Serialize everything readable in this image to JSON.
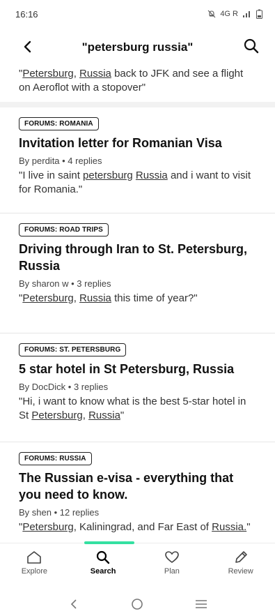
{
  "status": {
    "time": "16:16",
    "icons_text": "4G R"
  },
  "header": {
    "title": "\"petersburg russia\""
  },
  "results": [
    {
      "snippet_parts": [
        {
          "t": "\""
        },
        {
          "t": "Petersburg",
          "u": true
        },
        {
          "t": ", "
        },
        {
          "t": "Russia",
          "u": true
        },
        {
          "t": " back to JFK and see a flight on Aeroflot with a stopover\""
        }
      ]
    },
    {
      "category": "FORUMS: ROMANIA",
      "title": "Invitation letter for Romanian Visa",
      "meta": "By perdita • 4 replies",
      "snippet_parts": [
        {
          "t": "\"I live in saint "
        },
        {
          "t": "petersburg",
          "u": true
        },
        {
          "t": " "
        },
        {
          "t": "Russia",
          "u": true
        },
        {
          "t": " and i want to visit for Romania.\""
        }
      ]
    },
    {
      "category": "FORUMS: ROAD TRIPS",
      "title": "Driving through Iran to St. Petersburg, Russia",
      "meta": "By sharon w • 3 replies",
      "snippet_parts": [
        {
          "t": "\""
        },
        {
          "t": "Petersburg",
          "u": true
        },
        {
          "t": ", "
        },
        {
          "t": "Russia",
          "u": true
        },
        {
          "t": " this time of year?\""
        }
      ]
    },
    {
      "category": "FORUMS: ST. PETERSBURG",
      "title": "5 star hotel in St Petersburg, Russia",
      "meta": "By DocDick • 3 replies",
      "snippet_parts": [
        {
          "t": "\"Hi, i want to know what is the best 5-star hotel in St "
        },
        {
          "t": "Petersburg",
          "u": true
        },
        {
          "t": ", "
        },
        {
          "t": "Russia",
          "u": true
        },
        {
          "t": "\""
        }
      ]
    },
    {
      "category": "FORUMS: RUSSIA",
      "title": "The Russian e-visa - everything that you need to know.",
      "meta": "By shen • 12 replies",
      "snippet_parts": [
        {
          "t": "\""
        },
        {
          "t": "Petersburg",
          "u": true
        },
        {
          "t": ", Kaliningrad, and Far East of "
        },
        {
          "t": "Russia.",
          "u": true
        },
        {
          "t": "\""
        }
      ]
    }
  ],
  "bottom_nav": [
    {
      "label": "Explore",
      "icon": "home-icon",
      "active": false
    },
    {
      "label": "Search",
      "icon": "search-icon",
      "active": true
    },
    {
      "label": "Plan",
      "icon": "heart-icon",
      "active": false
    },
    {
      "label": "Review",
      "icon": "pencil-icon",
      "active": false
    }
  ],
  "colors": {
    "accent": "#34e0a1"
  }
}
